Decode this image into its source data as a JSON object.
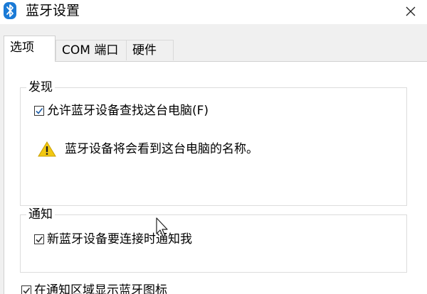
{
  "window": {
    "title": "蓝牙设置",
    "icons": {
      "app": "bluetooth-icon",
      "close": "close-icon"
    }
  },
  "tabs": [
    {
      "label": "选项",
      "active": true
    },
    {
      "label": "COM 端口",
      "active": false
    },
    {
      "label": "硬件",
      "active": false
    }
  ],
  "discovery": {
    "legend": "发现",
    "allow_label": "允许蓝牙设备查找这台电脑(F)",
    "allow_checked": true,
    "warning_icon": "warning-icon",
    "warning_text": "蓝牙设备将会看到这台电脑的名称。"
  },
  "notify": {
    "legend": "通知",
    "new_device_label": "新蓝牙设备要连接时通知我",
    "new_device_checked": true
  },
  "tray": {
    "show_icon_label": "在通知区域显示蓝牙图标",
    "show_icon_checked": true
  },
  "colors": {
    "bluetooth_badge": "#1a7ad6",
    "warning_yellow": "#f2c811",
    "check": "#1f5ea8"
  }
}
